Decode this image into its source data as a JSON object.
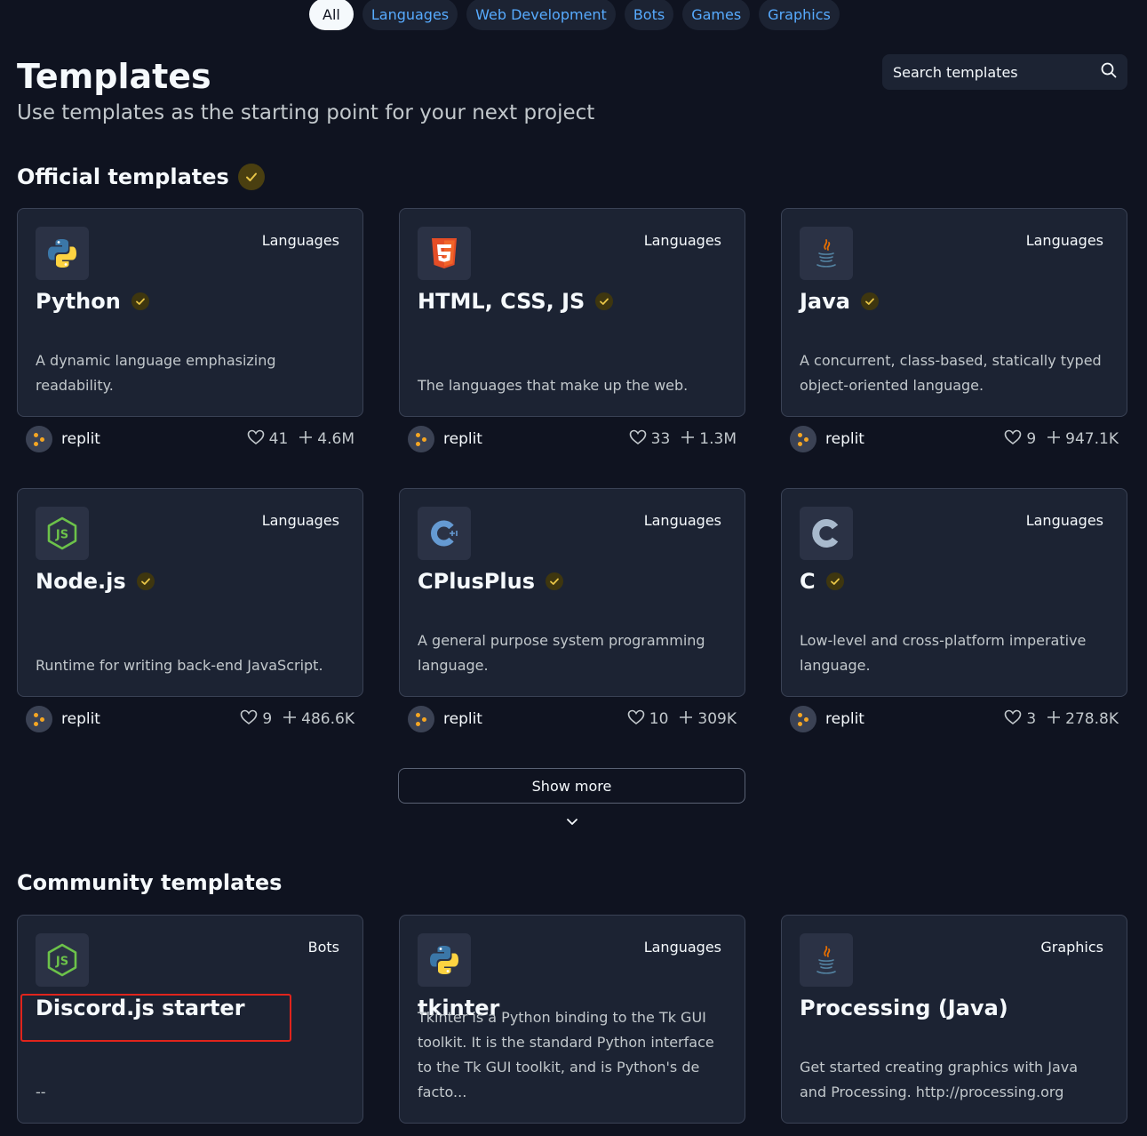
{
  "filters": [
    {
      "label": "All",
      "active": true
    },
    {
      "label": "Languages"
    },
    {
      "label": "Web Development"
    },
    {
      "label": "Bots"
    },
    {
      "label": "Games"
    },
    {
      "label": "Graphics"
    }
  ],
  "header": {
    "title": "Templates",
    "subtitle": "Use templates as the starting point for your next project",
    "search_placeholder": "Search templates"
  },
  "official": {
    "title": "Official templates",
    "cards": [
      {
        "title": "Python",
        "category": "Languages",
        "desc": "A dynamic language emphasizing readability.",
        "author": "replit",
        "likes": "41",
        "forks": "4.6M",
        "icon": "python-icon"
      },
      {
        "title": "HTML, CSS, JS",
        "category": "Languages",
        "desc": "The languages that make up the web.",
        "author": "replit",
        "likes": "33",
        "forks": "1.3M",
        "icon": "html5-icon"
      },
      {
        "title": "Java",
        "category": "Languages",
        "desc": "A concurrent, class-based, statically typed object-oriented language.",
        "author": "replit",
        "likes": "9",
        "forks": "947.1K",
        "icon": "java-icon"
      },
      {
        "title": "Node.js",
        "category": "Languages",
        "desc": "Runtime for writing back-end JavaScript.",
        "author": "replit",
        "likes": "9",
        "forks": "486.6K",
        "icon": "nodejs-icon"
      },
      {
        "title": "CPlusPlus",
        "category": "Languages",
        "desc": "A general purpose system programming language.",
        "author": "replit",
        "likes": "10",
        "forks": "309K",
        "icon": "cplusplus-icon"
      },
      {
        "title": "C",
        "category": "Languages",
        "desc": "Low-level and cross-platform imperative language.",
        "author": "replit",
        "likes": "3",
        "forks": "278.8K",
        "icon": "c-icon"
      }
    ],
    "show_more": "Show more"
  },
  "community": {
    "title": "Community templates",
    "cards": [
      {
        "title": "Discord.js starter",
        "category": "Bots",
        "desc": "--",
        "icon": "nodejs-icon"
      },
      {
        "title": "tkinter",
        "category": "Languages",
        "desc": "Tkinter is a Python binding to the Tk GUI toolkit. It is the standard Python interface to the Tk GUI toolkit, and is Python's de facto...",
        "icon": "python-icon"
      },
      {
        "title": "Processing (Java)",
        "category": "Graphics",
        "desc": "Get started creating graphics with Java and Processing. http://processing.org",
        "icon": "java-icon"
      }
    ]
  },
  "colors": {
    "background": "#0f1320",
    "card": "#1c2333",
    "accent_link": "#57abff",
    "verified": "#d4a80a",
    "highlight": "#e0241c"
  }
}
